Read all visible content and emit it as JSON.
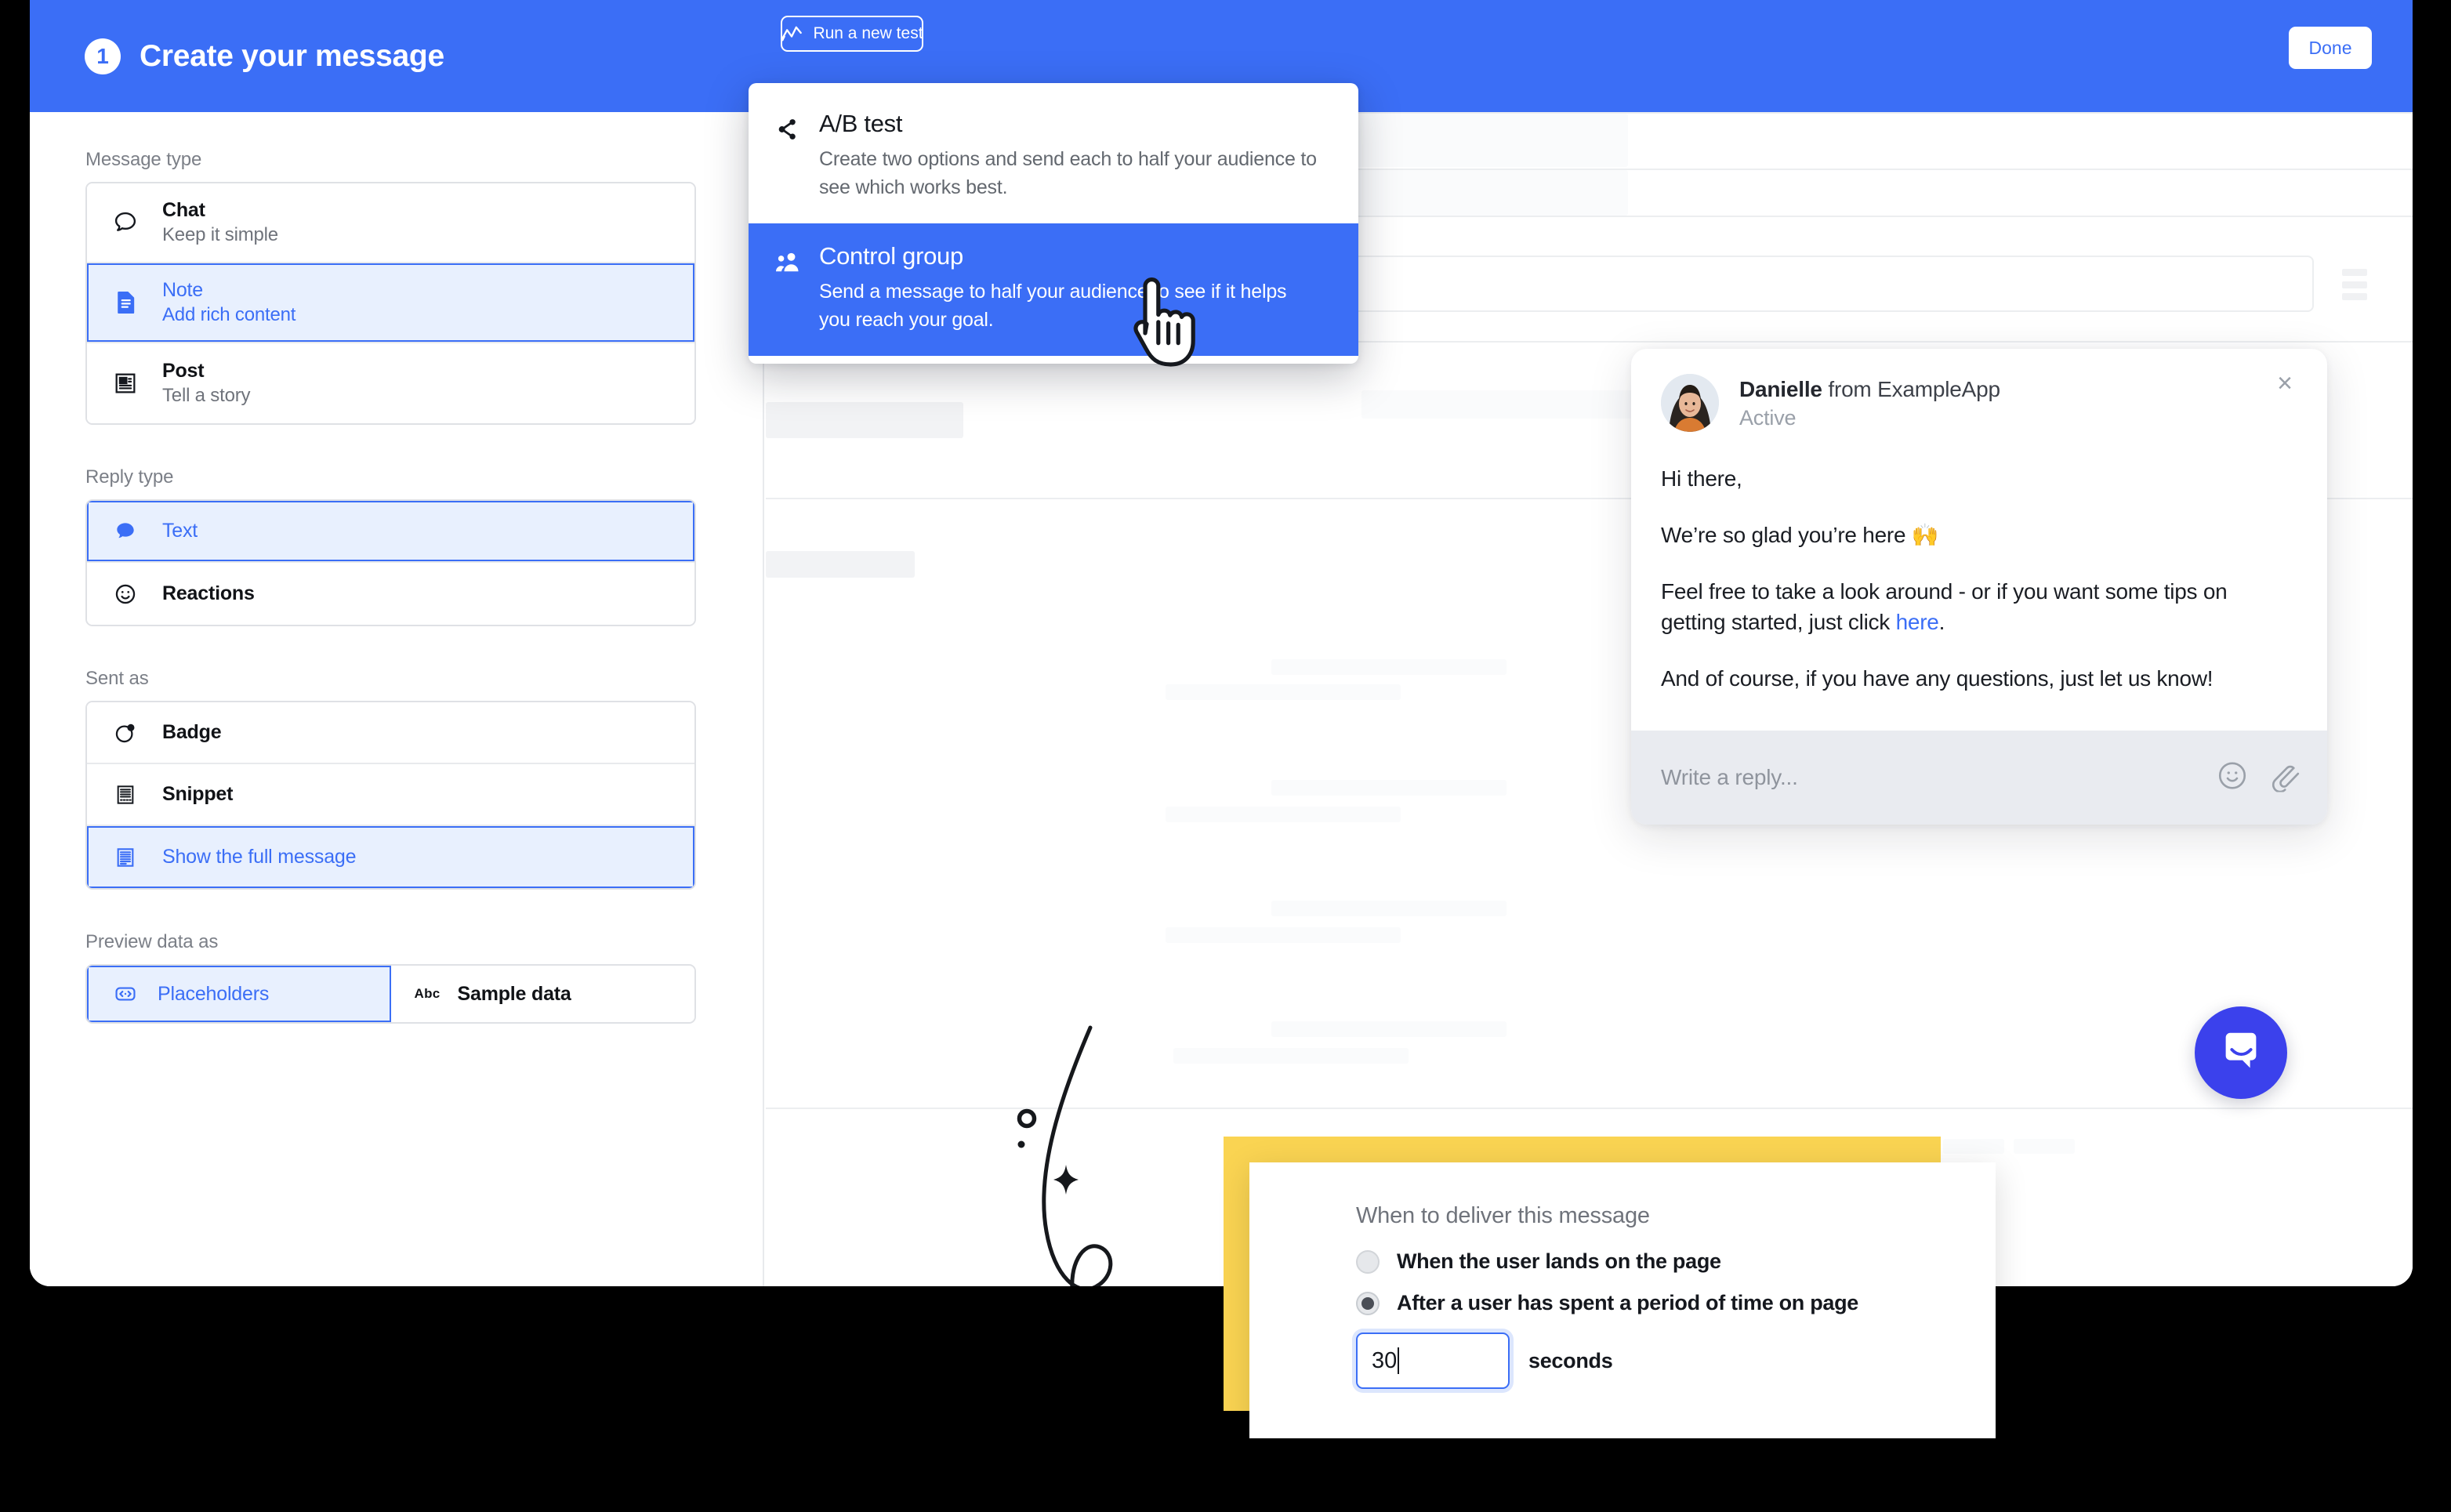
{
  "header": {
    "step_number": "1",
    "title": "Create your message",
    "run_test_label": "Run a new test",
    "done_label": "Done"
  },
  "dropdown": {
    "items": [
      {
        "icon": "share-nodes-icon",
        "title": "A/B test",
        "description": "Create two options and send each to half your audience to see which works best.",
        "active": false
      },
      {
        "icon": "people-group-icon",
        "title": "Control group",
        "description": "Send a message to half your audience to see if it helps you reach your goal.",
        "active": true
      }
    ]
  },
  "sidebar": {
    "groups": [
      {
        "label": "Message type",
        "type": "list",
        "items": [
          {
            "icon": "speech-bubble-icon",
            "title": "Chat",
            "sub": "Keep it simple",
            "selected": false
          },
          {
            "icon": "note-document-icon",
            "title": "Note",
            "sub": "Add rich content",
            "selected": true
          },
          {
            "icon": "post-article-icon",
            "title": "Post",
            "sub": "Tell a story",
            "selected": false
          }
        ]
      },
      {
        "label": "Reply type",
        "type": "list",
        "items": [
          {
            "icon": "chat-filled-icon",
            "title": "Text",
            "selected": true
          },
          {
            "icon": "smiley-face-icon",
            "title": "Reactions",
            "selected": false
          }
        ]
      },
      {
        "label": "Sent as",
        "type": "list",
        "items": [
          {
            "icon": "badge-circle-icon",
            "title": "Badge",
            "selected": false
          },
          {
            "icon": "snippet-lines-icon",
            "title": "Snippet",
            "selected": false
          },
          {
            "icon": "full-message-icon",
            "title": "Show the full message",
            "selected": true
          }
        ]
      },
      {
        "label": "Preview data as",
        "type": "segmented",
        "items": [
          {
            "icon": "placeholder-brackets-icon",
            "title": "Placeholders",
            "selected": true
          },
          {
            "icon": "abc-text-icon",
            "title": "Sample data",
            "selected": false,
            "glyph": "Abc"
          }
        ]
      }
    ]
  },
  "messenger": {
    "sender_name": "Danielle",
    "sender_from": " from ExampleApp",
    "status": "Active",
    "close_label": "×",
    "paragraphs": [
      "Hi there,",
      "We’re so glad you’re here 🙌",
      "Feel free to take a look around - or if you want some tips on getting started, just click ",
      "And of course, if you have any questions, just let us know!"
    ],
    "link_text": "here",
    "link_suffix": ".",
    "reply_placeholder": "Write a reply...",
    "emoji_icon": "smiley-icon",
    "attach_icon": "paperclip-icon",
    "launcher_icon": "messenger-launcher-icon"
  },
  "callout": {
    "title": "When to deliver this message",
    "options": [
      {
        "label": "When the user lands on the page",
        "selected": false
      },
      {
        "label": "After a user has spent a period of time on page",
        "selected": true
      }
    ],
    "seconds_value": "30",
    "seconds_label": "seconds"
  },
  "colors": {
    "brand_blue": "#3b6ef6",
    "launcher_blue": "#3b41ec",
    "accent_yellow": "#fad452",
    "selected_bg": "#e8f0fe"
  }
}
